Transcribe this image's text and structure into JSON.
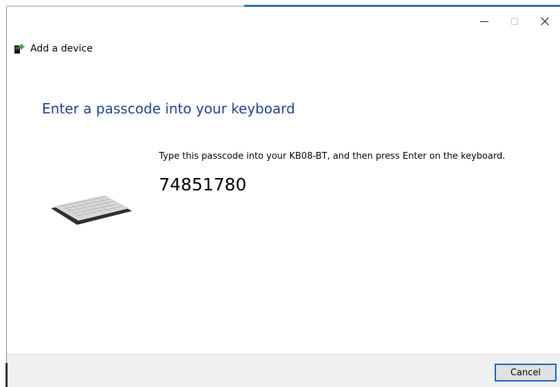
{
  "window": {
    "title": "Add a device",
    "controls": {
      "minimize": "minimize-icon",
      "maximize": "maximize-icon",
      "close": "close-icon"
    },
    "accent_color": "#1e6fc8"
  },
  "main": {
    "heading": "Enter a passcode into your keyboard",
    "heading_color": "#1b3f95",
    "instruction": "Type this passcode into your KB08-BT, and then press Enter on the keyboard.",
    "passcode": "74851780",
    "image": "keyboard-illustration"
  },
  "footer": {
    "cancel_label": "Cancel"
  }
}
